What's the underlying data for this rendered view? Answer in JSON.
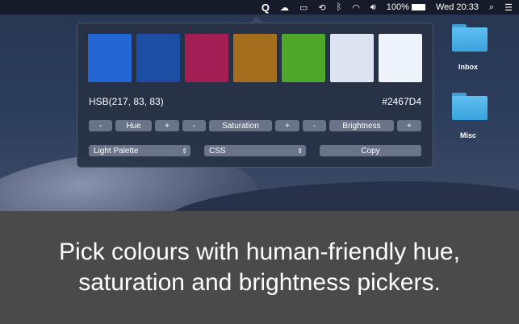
{
  "menubar": {
    "app_icon": "Q",
    "items": [
      "cloud-upload-icon",
      "airplay-icon",
      "time-machine-icon",
      "bluetooth-icon",
      "wifi-icon",
      "volume-icon"
    ],
    "battery": "100%",
    "clock": "Wed 20:33"
  },
  "popup": {
    "swatches": [
      "#2467D4",
      "#1D4EA3",
      "#A31E52",
      "#A56D1E",
      "#4FA82A",
      "#DCE4F1",
      "#EEF3FC"
    ],
    "hsb": "HSB(217, 83, 83)",
    "hex": "#2467D4",
    "buttons": {
      "minus": "-",
      "plus": "+",
      "hue": "Hue",
      "saturation": "Saturation",
      "brightness": "Brightness"
    },
    "palette": "Light Palette",
    "format": "CSS",
    "copy": "Copy"
  },
  "desktop": {
    "folders": [
      "Inbox",
      "Misc"
    ]
  },
  "caption": {
    "line1": "Pick colours with human-friendly hue,",
    "line2": "saturation and brightness pickers."
  }
}
